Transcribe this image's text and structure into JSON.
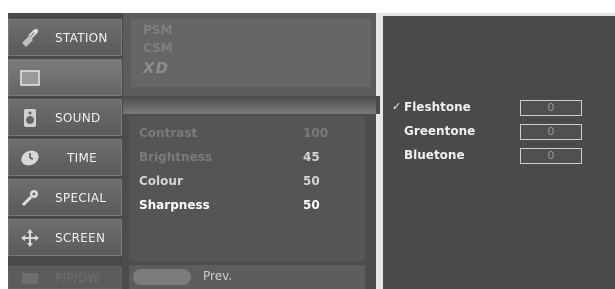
{
  "menu": {
    "station": "STATION",
    "sound": "SOUND",
    "time": "TIME",
    "special": "SPECIAL",
    "screen": "SCREEN",
    "pipdw": "PIP/DW"
  },
  "picture_modes": {
    "psm": "PSM",
    "csm": "CSM",
    "xd": "XD"
  },
  "settings": [
    {
      "name": "Contrast",
      "value": "100"
    },
    {
      "name": "Brightness",
      "value": "45"
    },
    {
      "name": "Colour",
      "value": "50"
    },
    {
      "name": "Sharpness",
      "value": "50"
    }
  ],
  "prev_label": "Prev.",
  "tones": [
    {
      "check": "✓",
      "name": "Fleshtone",
      "value": "0"
    },
    {
      "check": "",
      "name": "Greentone",
      "value": "0"
    },
    {
      "check": "",
      "name": "Bluetone",
      "value": "0"
    }
  ]
}
